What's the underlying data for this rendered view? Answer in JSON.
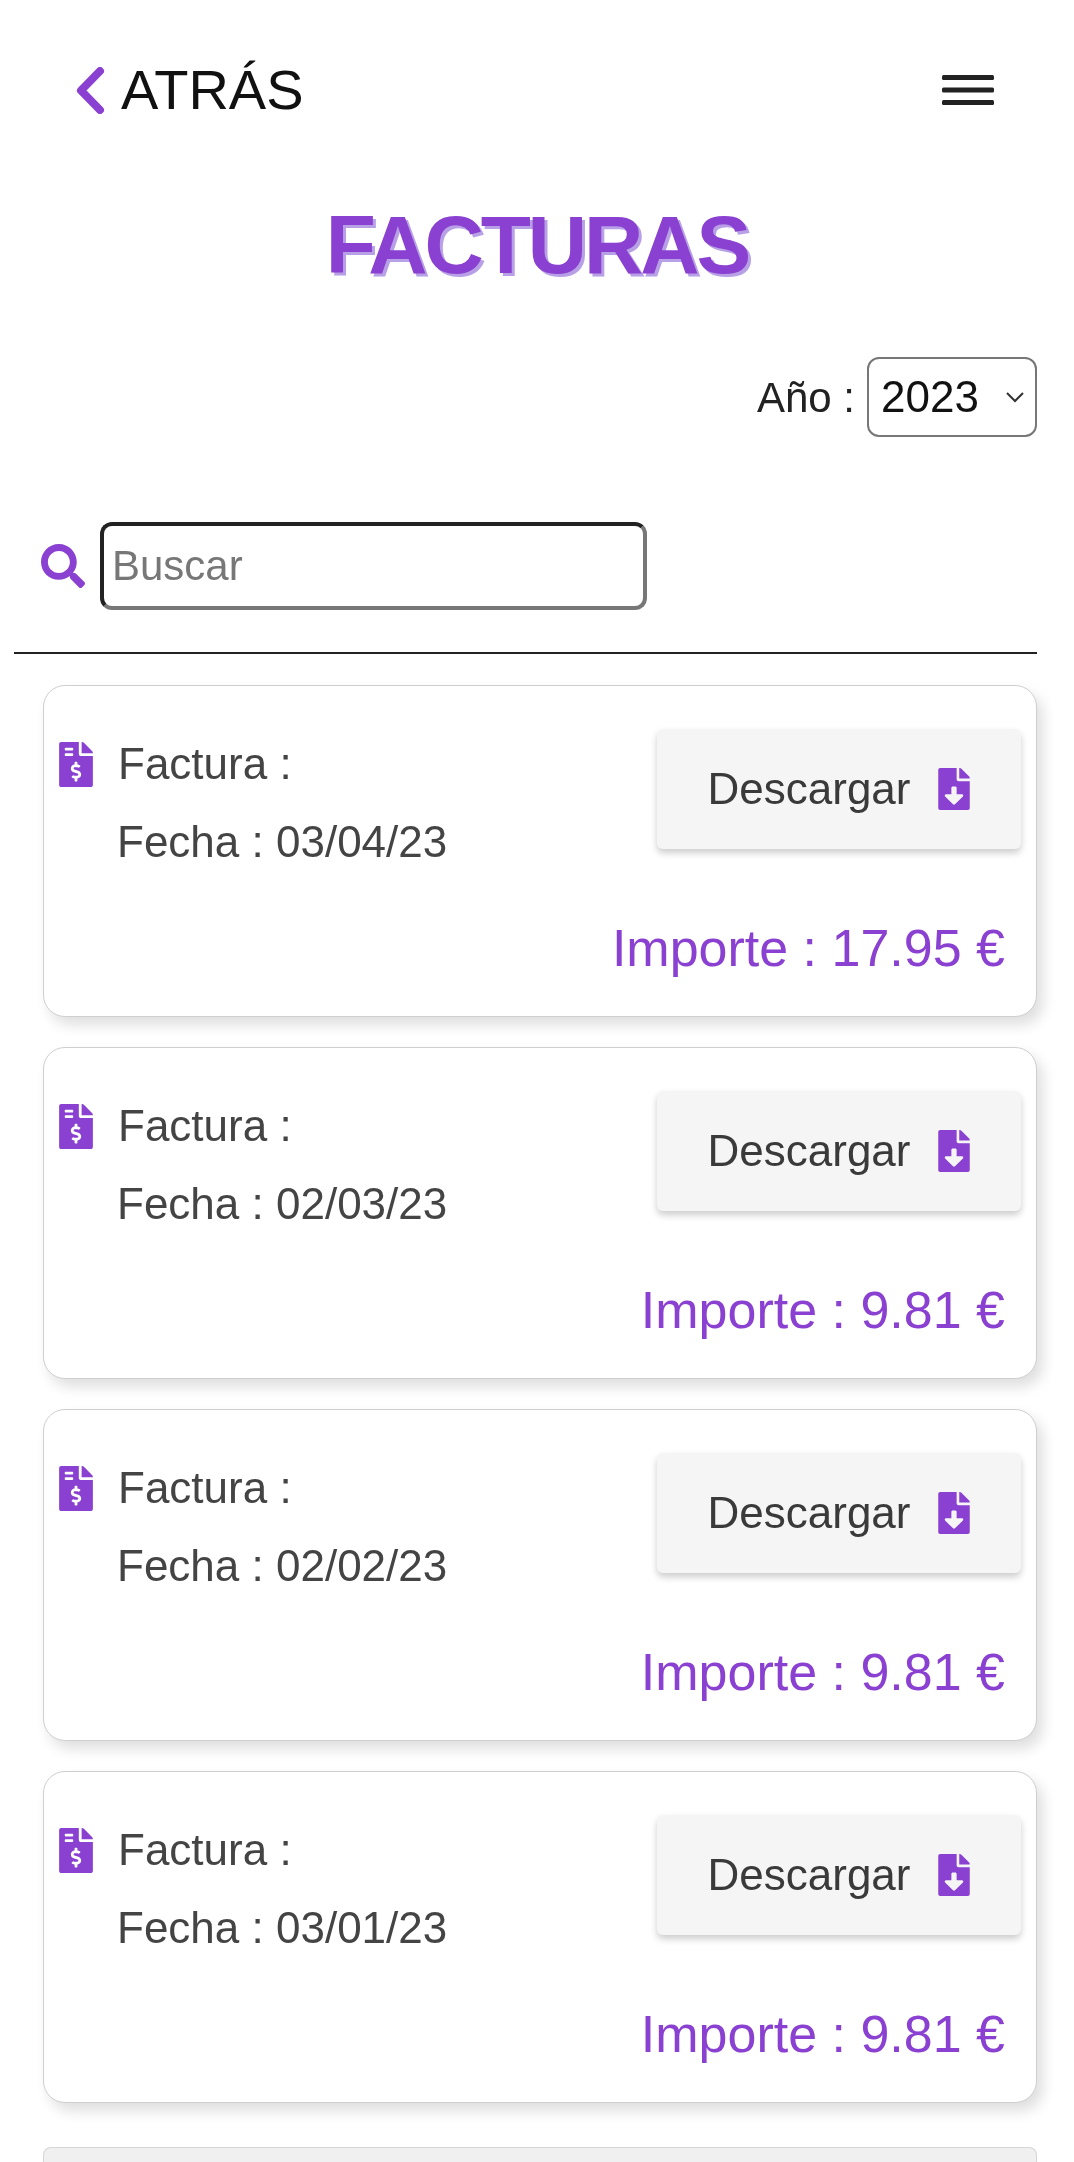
{
  "header": {
    "back_link": {
      "label": "ATRÁS"
    }
  },
  "title": "FACTURAS",
  "year_filter": {
    "label": "Año :",
    "value": "2023"
  },
  "search": {
    "placeholder": "Buscar"
  },
  "invoices": [
    {
      "invoice_label": "Factura :",
      "date": "Fecha : 03/04/23",
      "download_button": "Descargar",
      "amount": "Importe : 17.95 €"
    },
    {
      "invoice_label": "Factura :",
      "date": "Fecha : 02/03/23",
      "download_button": "Descargar",
      "amount": "Importe : 9.81 €"
    },
    {
      "invoice_label": "Factura :",
      "date": "Fecha : 02/02/23",
      "download_button": "Descargar",
      "amount": "Importe : 9.81 €"
    },
    {
      "invoice_label": "Factura :",
      "date": "Fecha : 03/01/23",
      "download_button": "Descargar",
      "amount": "Importe : 9.81 €"
    }
  ]
}
